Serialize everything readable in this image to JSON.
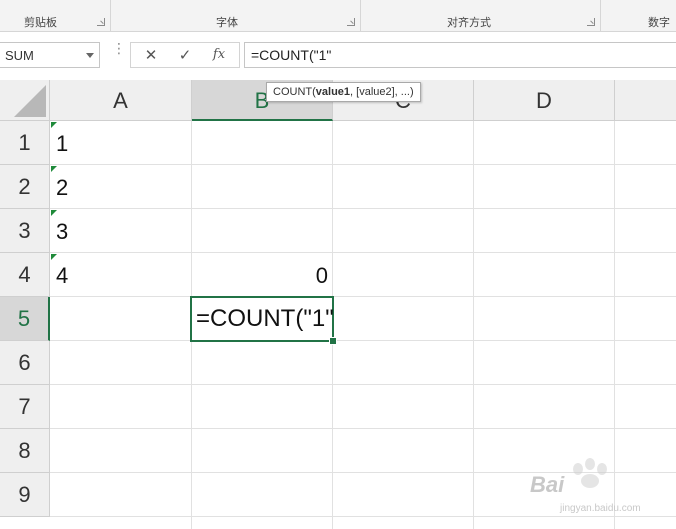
{
  "ribbon": {
    "groups": [
      {
        "label": "剪贴板"
      },
      {
        "label": "字体"
      },
      {
        "label": "对齐方式"
      },
      {
        "label": "数字"
      }
    ]
  },
  "formula_bar": {
    "name_box": "SUM",
    "cancel_icon": "✕",
    "enter_icon": "✓",
    "fx_icon": "fx",
    "formula": "=COUNT(\"1\""
  },
  "tooltip": {
    "prefix": "COUNT(",
    "bold_arg": "value1",
    "rest": ", [value2], ...)"
  },
  "columns": [
    "A",
    "B",
    "C",
    "D"
  ],
  "active_column": "B",
  "rows": [
    "1",
    "2",
    "3",
    "4",
    "5",
    "6",
    "7",
    "8",
    "9"
  ],
  "active_row": "5",
  "cells": {
    "A1": "1",
    "A2": "2",
    "A3": "3",
    "A4": "4",
    "B4": "0",
    "B5": "=COUNT(\"1\""
  },
  "watermark": {
    "text": "Bai",
    "sub": "jingyan.baidu.com"
  },
  "colors": {
    "accent": "#217346",
    "text_indicator": "#1f8a3a"
  }
}
